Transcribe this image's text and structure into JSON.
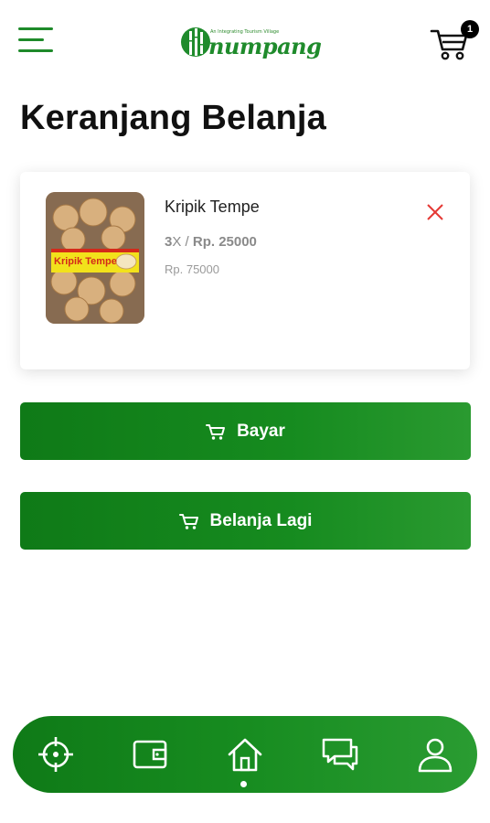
{
  "header": {
    "logo_tagline": "An Integrating Tourism Village",
    "logo_text": "numpang",
    "cart_count": "1"
  },
  "page": {
    "title": "Keranjang Belanja"
  },
  "cart": {
    "items": [
      {
        "name": "Kripik Tempe",
        "qty": "3",
        "qty_sep": "X / ",
        "price": "Rp. 25000",
        "total": "Rp. 75000",
        "image_label": "Kripik Tempe"
      }
    ]
  },
  "actions": {
    "pay_label": "Bayar",
    "shop_again_label": "Belanja Lagi"
  },
  "bottom_nav": {
    "items": [
      {
        "icon": "crosshair-icon"
      },
      {
        "icon": "wallet-icon"
      },
      {
        "icon": "home-icon",
        "active": true
      },
      {
        "icon": "chat-icon"
      },
      {
        "icon": "user-icon"
      }
    ]
  },
  "colors": {
    "brand_green": "#168b1f",
    "remove_red": "#e53935",
    "badge_black": "#000000"
  }
}
